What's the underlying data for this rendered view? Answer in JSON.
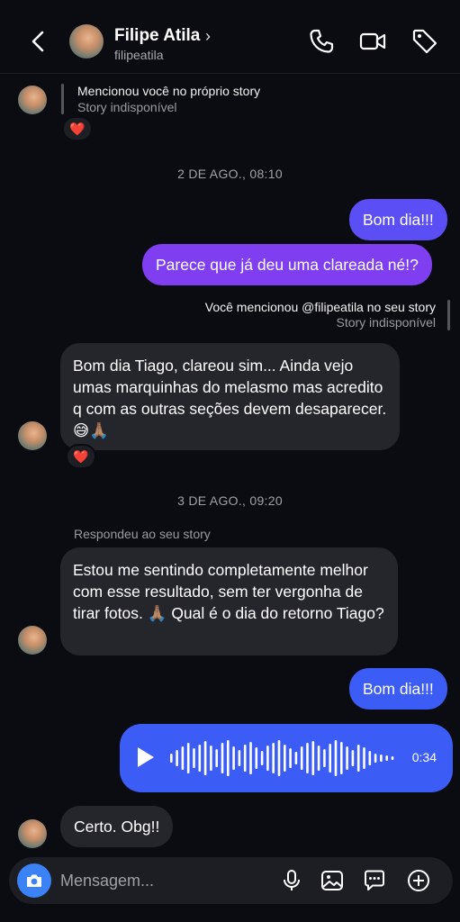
{
  "header": {
    "name": "Filipe Atila",
    "username": "filipeatila",
    "chevron": "›"
  },
  "messages": {
    "story_mention_in": {
      "line1": "Mencionou você no próprio story",
      "line2": "Story indisponível",
      "reaction": "❤️"
    },
    "stamp1": "2 DE AGO., 08:10",
    "out1": "Bom dia!!!",
    "out2": "Parece que já deu uma clareada né!?",
    "story_mention_out": {
      "line1": "Você mencionou @filipeatila no seu story",
      "line2": "Story indisponível"
    },
    "in1": "Bom dia Tiago, clareou sim... Ainda vejo umas marquinhas do melasmo mas acredito q com as outras seções devem desaparecer. 😅🙏🏽",
    "in1_reaction": "❤️",
    "stamp2": "3 DE AGO., 09:20",
    "replied_label": "Respondeu ao seu story",
    "in2": "Estou me sentindo completamente melhor com esse resultado, sem ter vergonha de tirar fotos. 🙏🏽 Qual é o dia do retorno Tiago?",
    "out3": "Bom dia!!!",
    "voice_duration": "0:34",
    "in3": "Certo. Obg!!"
  },
  "composer": {
    "placeholder": "Mensagem...",
    "icons": [
      "camera-icon",
      "microphone-icon",
      "image-icon",
      "sticker-icon",
      "plus-icon"
    ]
  },
  "colors": {
    "background": "#0b0c11",
    "incoming": "#25262c",
    "outgoing_blue": "#3b5df6",
    "outgoing_purple": "#7f3ff0"
  }
}
